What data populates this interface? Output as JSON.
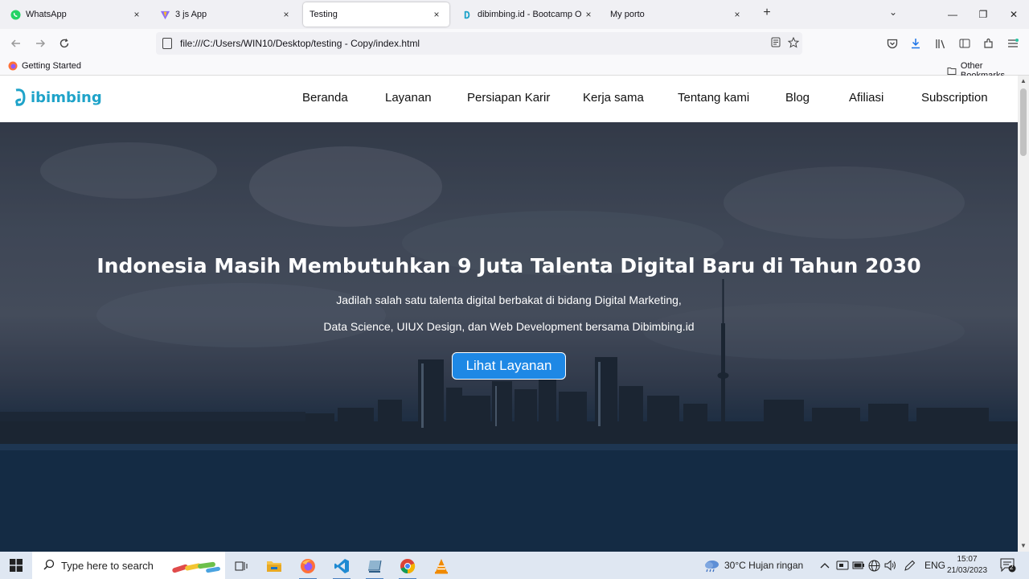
{
  "browser": {
    "tabs": [
      {
        "title": "WhatsApp",
        "icon": "whatsapp-icon",
        "close": "×"
      },
      {
        "title": "3 js App",
        "icon": "vite-icon",
        "close": "×"
      },
      {
        "title": "Testing",
        "icon": "none",
        "close": "×",
        "active": true
      },
      {
        "title": "dibimbing.id - Bootcamp Online",
        "icon": "dibimbing-icon",
        "close": "×"
      },
      {
        "title": "My porto",
        "icon": "none",
        "close": "×"
      }
    ],
    "new_tab": "+",
    "list_tabs": "⌄",
    "window_controls": {
      "minimize": "—",
      "restore": "❐",
      "close": "✕"
    },
    "url": "file:///C:/Users/WIN10/Desktop/testing - Copy/index.html",
    "bookmarks": {
      "getting_started": "Getting Started",
      "other": "Other Bookmarks"
    }
  },
  "site": {
    "logo_text": "ibimbing",
    "logo_color": "#1fa3c9",
    "nav": [
      "Beranda",
      "Layanan",
      "Persiapan Karir",
      "Kerja sama",
      "Tentang kami",
      "Blog",
      "Afiliasi",
      "Subscription"
    ],
    "hero": {
      "title": "Indonesia Masih Membutuhkan 9 Juta Talenta Digital Baru di Tahun 2030",
      "subtitle_line1": "Jadilah salah satu talenta digital berbakat di bidang Digital Marketing,",
      "subtitle_line2": "Data Science, UIUX Design, dan Web Development bersama Dibimbing.id",
      "button_label": "Lihat Layanan",
      "button_color": "#1e88e5"
    }
  },
  "taskbar": {
    "search_placeholder": "Type here to search",
    "weather": "30°C  Hujan ringan",
    "language": "ENG",
    "time": "15:07",
    "date": "21/03/2023",
    "notification_count": "2"
  }
}
